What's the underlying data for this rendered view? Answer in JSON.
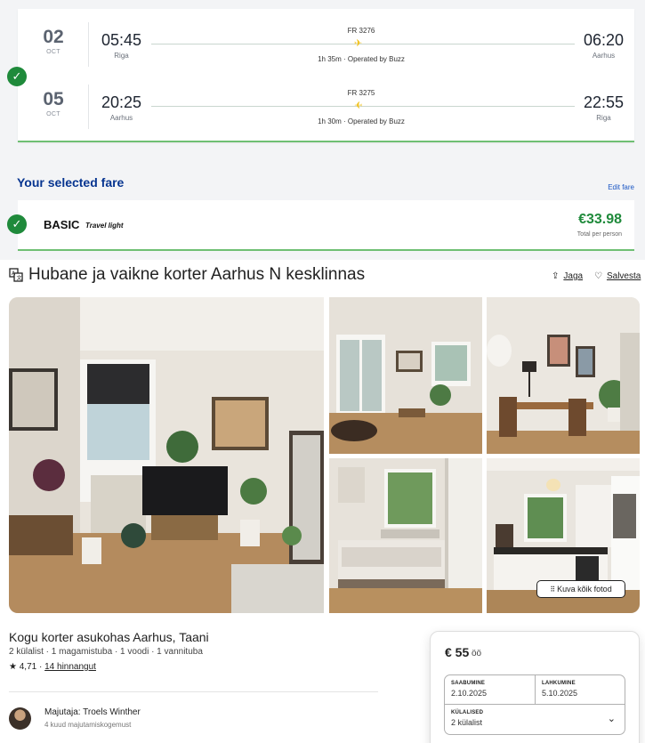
{
  "flights": [
    {
      "day": "02",
      "month": "OCT",
      "dep_time": "05:45",
      "dep_city": "Riga",
      "arr_time": "06:20",
      "arr_city": "Aarhus",
      "flight_no": "FR 3276",
      "duration": "1h 35m · Operated by Buzz"
    },
    {
      "day": "05",
      "month": "OCT",
      "dep_time": "20:25",
      "dep_city": "Aarhus",
      "arr_time": "22:55",
      "arr_city": "Riga",
      "flight_no": "FR 3275",
      "duration": "1h 30m · Operated by Buzz"
    }
  ],
  "fare": {
    "section_title": "Your selected fare",
    "edit_label": "Edit fare",
    "name": "BASIC",
    "subtitle": "Travel light",
    "price": "€33.98",
    "per_label": "Total per person"
  },
  "listing": {
    "title": "Hubane ja vaikne korter Aarhus N kesklinnas",
    "share_label": "Jaga",
    "save_label": "Salvesta",
    "show_all_photos": "Kuva kõik fotod",
    "summary_title": "Kogu korter asukohas Aarhus, Taani",
    "details": "2 külalist · 1 magamistuba · 1 voodi · 1 vannituba",
    "rating": "★ 4,71 ·",
    "reviews": "14 hinnangut",
    "host_name": "Majutaja: Troels Winther",
    "host_years": "4 kuud majutamiskogemust"
  },
  "booking": {
    "price": "€ 55",
    "price_unit": "öö",
    "checkin_label": "SAABUMINE",
    "checkin_value": "2.10.2025",
    "checkout_label": "LAHKUMINE",
    "checkout_value": "5.10.2025",
    "guests_label": "KÜLALISED",
    "guests_value": "2 külalist"
  },
  "colors": {
    "accent_green": "#1f8a3b",
    "fare_title_blue": "#073590",
    "plane_yellow": "#f2c21b"
  }
}
